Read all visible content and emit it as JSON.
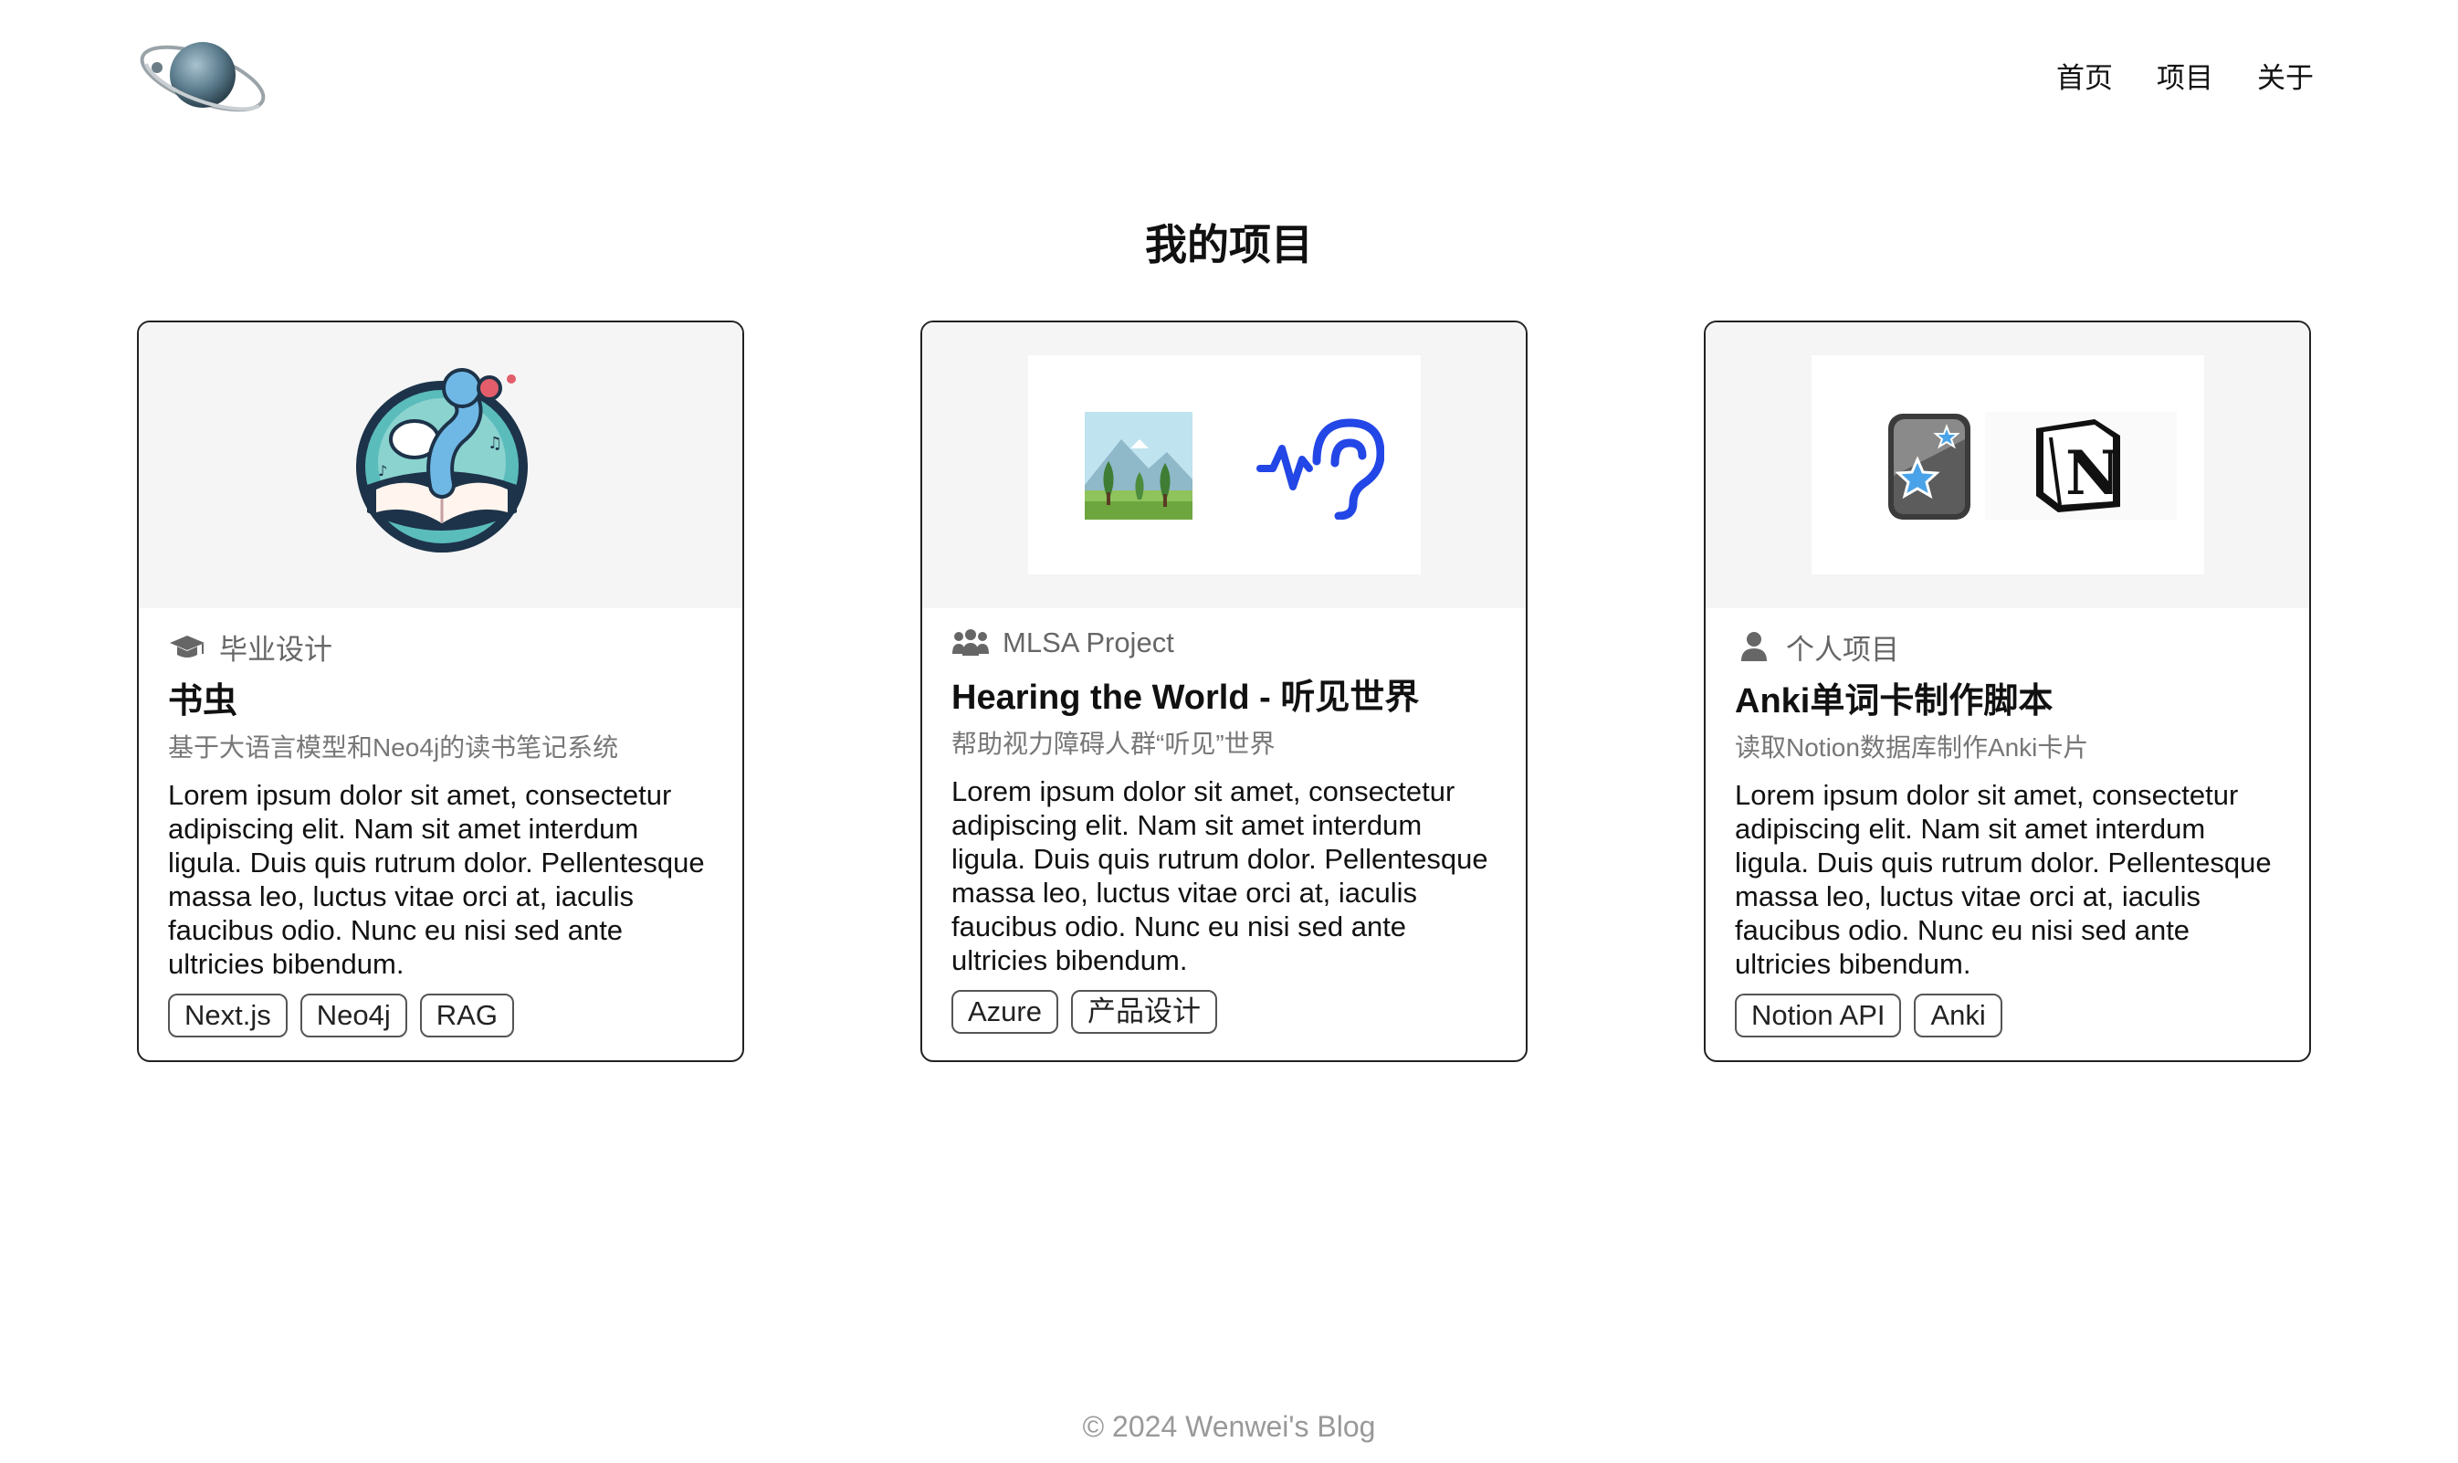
{
  "nav": {
    "home": "首页",
    "projects": "项目",
    "about": "关于"
  },
  "page_title": "我的项目",
  "cards": [
    {
      "category": "毕业设计",
      "category_icon": "graduation-cap-icon",
      "title": "书虫",
      "subtitle": "基于大语言模型和Neo4j的读书笔记系统",
      "description": "Lorem ipsum dolor sit amet, consectetur adipiscing elit. Nam sit amet interdum ligula. Duis quis rutrum dolor. Pellentesque massa leo, luctus vitae orci at, iaculis faucibus odio. Nunc eu nisi sed ante ultricies bibendum.",
      "tags": [
        "Next.js",
        "Neo4j",
        "RAG"
      ]
    },
    {
      "category": "MLSA Project",
      "category_icon": "users-icon",
      "title": "Hearing the World - 听见世界",
      "subtitle": "帮助视力障碍人群“听见”世界",
      "description": "Lorem ipsum dolor sit amet, consectetur adipiscing elit. Nam sit amet interdum ligula. Duis quis rutrum dolor. Pellentesque massa leo, luctus vitae orci at, iaculis faucibus odio. Nunc eu nisi sed ante ultricies bibendum.",
      "tags": [
        "Azure",
        "产品设计"
      ]
    },
    {
      "category": "个人项目",
      "category_icon": "user-icon",
      "title": "Anki单词卡制作脚本",
      "subtitle": "读取Notion数据库制作Anki卡片",
      "description": "Lorem ipsum dolor sit amet, consectetur adipiscing elit. Nam sit amet interdum ligula. Duis quis rutrum dolor. Pellentesque massa leo, luctus vitae orci at, iaculis faucibus odio. Nunc eu nisi sed ante ultricies bibendum.",
      "tags": [
        "Notion API",
        "Anki"
      ]
    }
  ],
  "footer": "© 2024 Wenwei's Blog"
}
